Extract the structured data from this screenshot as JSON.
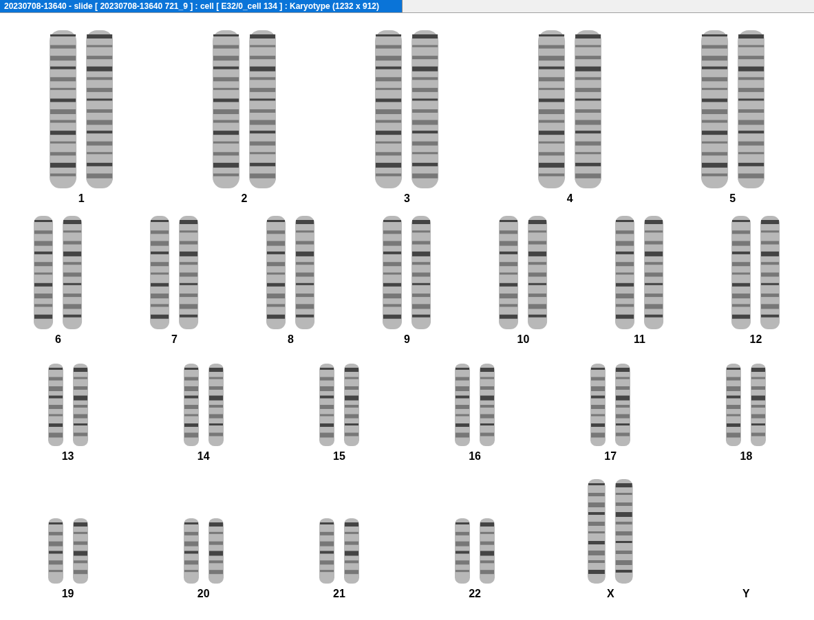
{
  "window": {
    "title": "20230708-13640 - slide [ 20230708-13640 721_9 ] : cell [ E32/0_cell 134 ] : Karyotype  (1232 x 912)"
  },
  "karyotype": {
    "rows": [
      {
        "chromosomes": [
          {
            "label": "1",
            "kind": "pair"
          },
          {
            "label": "2",
            "kind": "pair"
          },
          {
            "label": "3",
            "kind": "pair"
          },
          {
            "label": "4",
            "kind": "pair"
          },
          {
            "label": "5",
            "kind": "pair"
          }
        ]
      },
      {
        "chromosomes": [
          {
            "label": "6",
            "kind": "pair"
          },
          {
            "label": "7",
            "kind": "pair"
          },
          {
            "label": "8",
            "kind": "pair"
          },
          {
            "label": "9",
            "kind": "pair"
          },
          {
            "label": "10",
            "kind": "pair"
          },
          {
            "label": "11",
            "kind": "pair"
          },
          {
            "label": "12",
            "kind": "pair"
          }
        ]
      },
      {
        "chromosomes": [
          {
            "label": "13",
            "kind": "pair"
          },
          {
            "label": "14",
            "kind": "pair"
          },
          {
            "label": "15",
            "kind": "pair"
          },
          {
            "label": "16",
            "kind": "pair"
          },
          {
            "label": "17",
            "kind": "pair"
          },
          {
            "label": "18",
            "kind": "pair"
          }
        ]
      },
      {
        "chromosomes": [
          {
            "label": "19",
            "kind": "pair"
          },
          {
            "label": "20",
            "kind": "pair"
          },
          {
            "label": "21",
            "kind": "pair"
          },
          {
            "label": "22",
            "kind": "pair"
          },
          {
            "label": "X",
            "kind": "long-pair"
          },
          {
            "label": "Y",
            "kind": "empty"
          }
        ]
      }
    ]
  }
}
